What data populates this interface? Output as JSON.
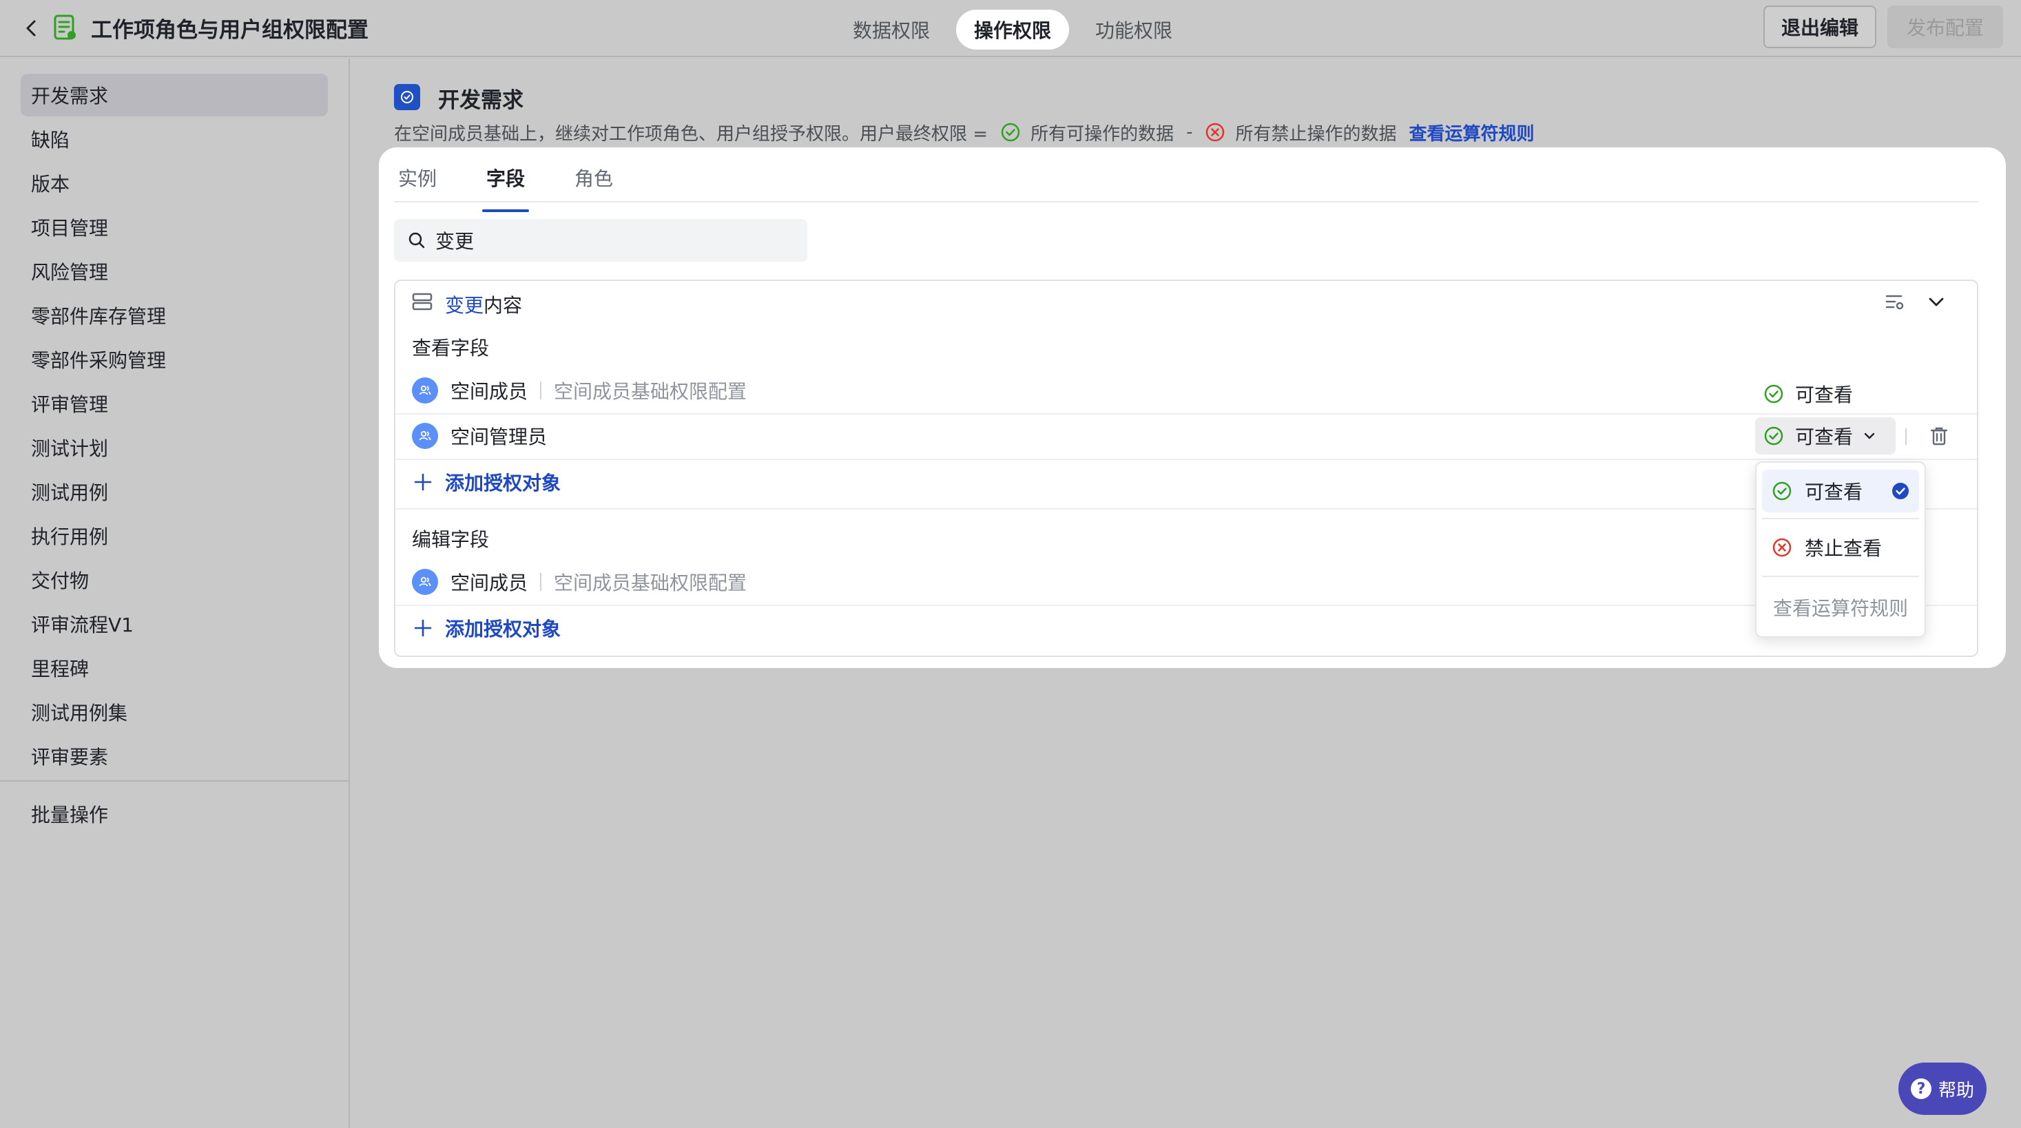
{
  "header": {
    "title": "工作项角色与用户组权限配置",
    "tabs": [
      {
        "label": "数据权限",
        "active": false
      },
      {
        "label": "操作权限",
        "active": true
      },
      {
        "label": "功能权限",
        "active": false
      }
    ],
    "exit_label": "退出编辑",
    "publish_label": "发布配置"
  },
  "sidebar": {
    "items": [
      {
        "label": "开发需求",
        "active": true
      },
      {
        "label": "缺陷"
      },
      {
        "label": "版本"
      },
      {
        "label": "项目管理"
      },
      {
        "label": "风险管理"
      },
      {
        "label": "零部件库存管理"
      },
      {
        "label": "零部件采购管理"
      },
      {
        "label": "评审管理"
      },
      {
        "label": "测试计划"
      },
      {
        "label": "测试用例"
      },
      {
        "label": "执行用例"
      },
      {
        "label": "交付物"
      },
      {
        "label": "评审流程V1"
      },
      {
        "label": "里程碑"
      },
      {
        "label": "测试用例集"
      },
      {
        "label": "评审要素"
      }
    ],
    "batch_label": "批量操作"
  },
  "content": {
    "title": "开发需求",
    "desc_prefix": "在空间成员基础上，继续对工作项角色、用户组授予权限。用户最终权限 =",
    "desc_allowed": "所有可操作的数据",
    "desc_minus": "-",
    "desc_forbidden": "所有禁止操作的数据",
    "desc_link": "查看运算符规则",
    "tabs": [
      {
        "label": "实例"
      },
      {
        "label": "字段",
        "active": true
      },
      {
        "label": "角色"
      }
    ],
    "search_value": "变更",
    "card": {
      "title_highlight": "变更",
      "title_rest": "内容",
      "view_section": "查看字段",
      "view_rows": [
        {
          "name": "空间成员",
          "desc": "空间成员基础权限配置",
          "perm": "可查看"
        },
        {
          "name": "空间管理员",
          "desc": "",
          "perm": "可查看"
        }
      ],
      "add_label": "添加授权对象",
      "edit_section": "编辑字段",
      "edit_rows": [
        {
          "name": "空间成员",
          "desc": "空间成员基础权限配置"
        }
      ],
      "add_label_2": "添加授权对象"
    }
  },
  "dropdown": {
    "options": [
      {
        "label": "可查看",
        "selected": true
      },
      {
        "label": "禁止查看"
      }
    ],
    "footer": "查看运算符规则"
  },
  "help": {
    "label": "帮助",
    "glyph": "?"
  },
  "colors": {
    "accent": "#1f49c2",
    "success": "#2ea121",
    "danger": "#e0362a",
    "avatar": "#5b8ff9",
    "help": "#4a47b8"
  }
}
